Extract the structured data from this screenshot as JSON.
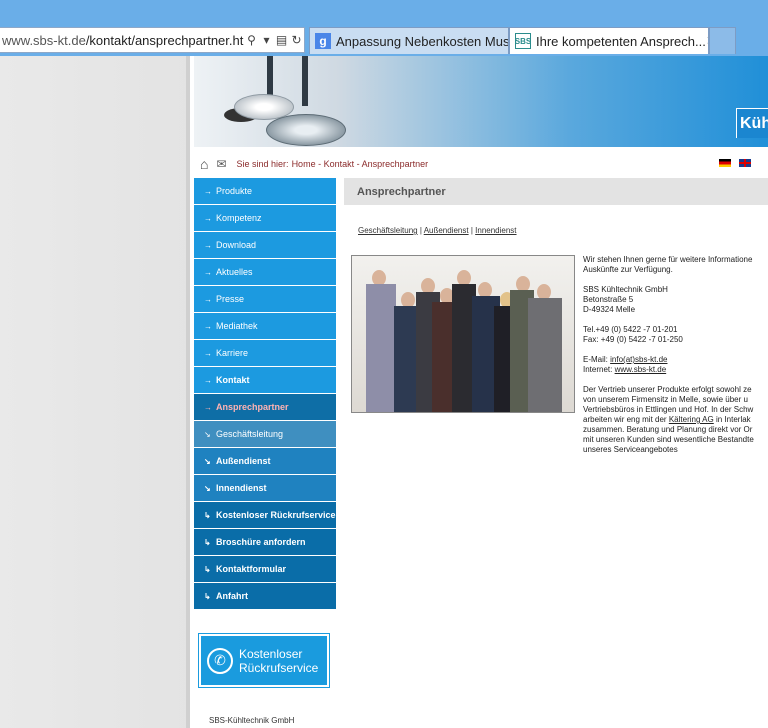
{
  "browser": {
    "address_url_host": "www.sbs-kt.de",
    "address_url_path": "/kontakt/ansprechpartner.htm",
    "tabs": [
      {
        "label": "Anpassung Nebenkosten Must..."
      },
      {
        "label": "Ihre kompetenten Ansprech..."
      }
    ],
    "icons": {
      "search": "search-icon",
      "refresh": "refresh-icon",
      "close": "close-icon"
    }
  },
  "header": {
    "brand_fragment": "Kühlt"
  },
  "topbar": {
    "crumb_label": "Sie sind hier:",
    "crumb": "Home - Kontakt - Ansprechpartner"
  },
  "nav": {
    "items": [
      {
        "label": "Produkte",
        "arrow": "→"
      },
      {
        "label": "Kompetenz",
        "arrow": "→"
      },
      {
        "label": "Download",
        "arrow": "→"
      },
      {
        "label": "Aktuelles",
        "arrow": "→"
      },
      {
        "label": "Presse",
        "arrow": "→"
      },
      {
        "label": "Mediathek",
        "arrow": "→"
      },
      {
        "label": "Karriere",
        "arrow": "→"
      },
      {
        "label": "Kontakt",
        "arrow": "→"
      },
      {
        "label": "Ansprechpartner",
        "arrow": "→"
      },
      {
        "label": "Geschäftsleitung",
        "arrow": "↘"
      },
      {
        "label": "Außendienst",
        "arrow": "↘"
      },
      {
        "label": "Innendienst",
        "arrow": "↘"
      },
      {
        "label": "Kostenloser Rückrufservice",
        "arrow": "↳"
      },
      {
        "label": "Broschüre anfordern",
        "arrow": "↳"
      },
      {
        "label": "Kontaktformular",
        "arrow": "↳"
      },
      {
        "label": "Anfahrt",
        "arrow": "↳"
      }
    ]
  },
  "rueckruf": {
    "line1": "Kostenloser",
    "line2": "Rückrufservice"
  },
  "footer": {
    "company": "SBS-Kühltechnik GmbH"
  },
  "content": {
    "title": "Ansprechpartner",
    "sublinks": [
      "Geschäftsleitung",
      "Außendienst",
      "Innendienst"
    ],
    "separator": "|",
    "intro_1": "Wir stehen Ihnen gerne für weitere Informatione",
    "intro_2": "Auskünfte zur Verfügung.",
    "company": "SBS Kühltechnik GmbH",
    "street": "Betonstraße 5",
    "city": "D-49324 Melle",
    "tel": "Tel.+49 (0) 5422 -7 01-201",
    "fax": "Fax: +49 (0) 5422 -7 01-250",
    "email_label": "E-Mail:",
    "email": "info(at)sbs-kt.de",
    "internet_label": "Internet:",
    "internet": "www.sbs-kt.de",
    "text_1": "Der Vertrieb unserer Produkte erfolgt sowohl ze",
    "text_2": "von unserem Firmensitz in Melle, sowie über u",
    "text_3": "Vertriebsbüros in Ettlingen und Hof. In der Schw",
    "text_4a": "arbeiten wir eng mit der",
    "text_4_link": "Kältering AG",
    "text_4b": "in Interlak",
    "text_5": "zusammen. Beratung und Planung direkt vor Or",
    "text_6": "mit unseren Kunden sind wesentliche Bestandte",
    "text_7": "unseres Serviceangebotes"
  }
}
